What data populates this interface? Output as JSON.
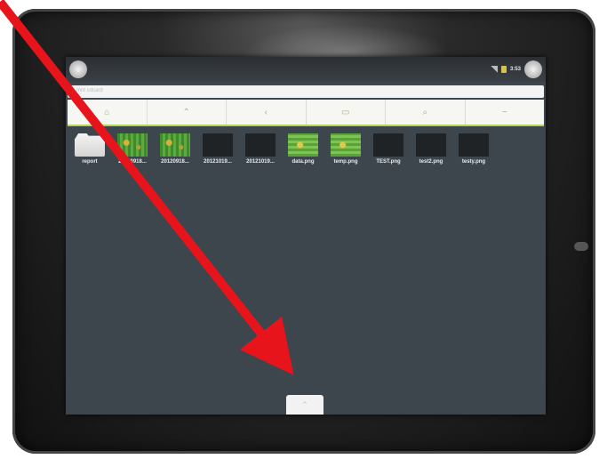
{
  "screen": {
    "status_bar": {
      "time": "3:53",
      "left_icon": "notification-badge-icon",
      "right_icons": [
        "signal-icon",
        "lock-icon",
        "system-badge-icon"
      ]
    },
    "path_bar": {
      "text": "mnt  sdcard"
    },
    "toolbar": {
      "buttons": [
        {
          "icon": "home-icon",
          "glyph": "⌂"
        },
        {
          "icon": "up-icon",
          "glyph": "⌃"
        },
        {
          "icon": "back-icon",
          "glyph": "‹"
        },
        {
          "icon": "folder-icon",
          "glyph": "▭"
        },
        {
          "icon": "search-icon",
          "glyph": "⌕"
        },
        {
          "icon": "menu-icon",
          "glyph": "−"
        }
      ]
    },
    "files": [
      {
        "label": "report",
        "kind": "folder"
      },
      {
        "label": "20120918...",
        "kind": "pcb"
      },
      {
        "label": "20120918...",
        "kind": "pcb"
      },
      {
        "label": "20121019...",
        "kind": "dark"
      },
      {
        "label": "20121019...",
        "kind": "dark"
      },
      {
        "label": "data.png",
        "kind": "pcb2"
      },
      {
        "label": "temp.png",
        "kind": "pcb2"
      },
      {
        "label": "TEST.png",
        "kind": "dark"
      },
      {
        "label": "test2.png",
        "kind": "dark"
      },
      {
        "label": "testy.png",
        "kind": "dark"
      }
    ],
    "dock": {
      "icon": "menu-tab-icon",
      "glyph": "⌃"
    }
  },
  "annotation": {
    "arrow_color": "#e8141c"
  }
}
